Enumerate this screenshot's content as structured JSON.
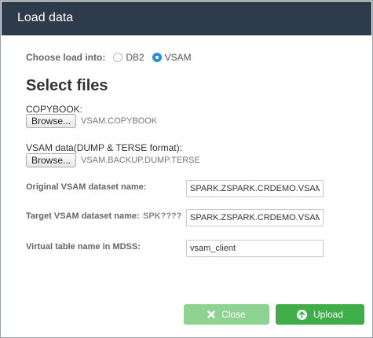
{
  "dialog": {
    "title": "Load data"
  },
  "load_into": {
    "label": "Choose load into:",
    "options": [
      {
        "label": "DB2",
        "selected": false
      },
      {
        "label": "VSAM",
        "selected": true
      }
    ]
  },
  "files": {
    "title": "Select files",
    "copybook": {
      "label": "COPYBOOK:",
      "browse_label": "Browse...",
      "file_name": "VSAM.COPYBOOK"
    },
    "vsam_data": {
      "label": "VSAM data(DUMP & TERSE format):",
      "browse_label": "Browse...",
      "file_name": "VSAM.BACKUP.DUMP.TERSE"
    }
  },
  "form": {
    "original_name": {
      "label": "Original VSAM dataset name:",
      "value": "SPARK.ZSPARK.CRDEMO.VSAM"
    },
    "target_name": {
      "label": "Target VSAM dataset name:",
      "hint": "SPK????",
      "value": "SPARK.ZSPARK.CRDEMO.VSAM"
    },
    "virtual_table": {
      "label": "Virtual table name in MDSS:",
      "value": "vsam_client"
    }
  },
  "footer": {
    "close_label": "Close",
    "upload_label": "Upload"
  },
  "colors": {
    "header_bg": "#2e3b4a",
    "radio_selected": "#2e8ddb",
    "close_button": "#8fd392",
    "upload_button": "#3fae49"
  }
}
